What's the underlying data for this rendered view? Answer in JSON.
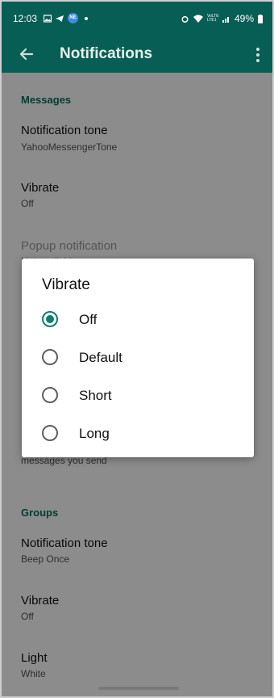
{
  "status_bar": {
    "time": "12:03",
    "notification_badge": "NE",
    "battery": "49%",
    "network": "VoLTE LTE1"
  },
  "app_bar": {
    "title": "Notifications"
  },
  "messages_section": {
    "header": "Messages",
    "items": [
      {
        "title": "Notification tone",
        "subtitle": "YahooMessengerTone"
      },
      {
        "title": "Vibrate",
        "subtitle": "Off"
      },
      {
        "title": "Popup notification",
        "subtitle": "Not available"
      }
    ],
    "partial_text": "messages you send"
  },
  "groups_section": {
    "header": "Groups",
    "items": [
      {
        "title": "Notification tone",
        "subtitle": "Beep Once"
      },
      {
        "title": "Vibrate",
        "subtitle": "Off"
      },
      {
        "title": "Light",
        "subtitle": "White"
      }
    ]
  },
  "dialog": {
    "title": "Vibrate",
    "options": [
      {
        "label": "Off",
        "selected": true
      },
      {
        "label": "Default",
        "selected": false
      },
      {
        "label": "Short",
        "selected": false
      },
      {
        "label": "Long",
        "selected": false
      }
    ]
  },
  "colors": {
    "primary": "#075e54",
    "accent": "#0b7e6f"
  }
}
